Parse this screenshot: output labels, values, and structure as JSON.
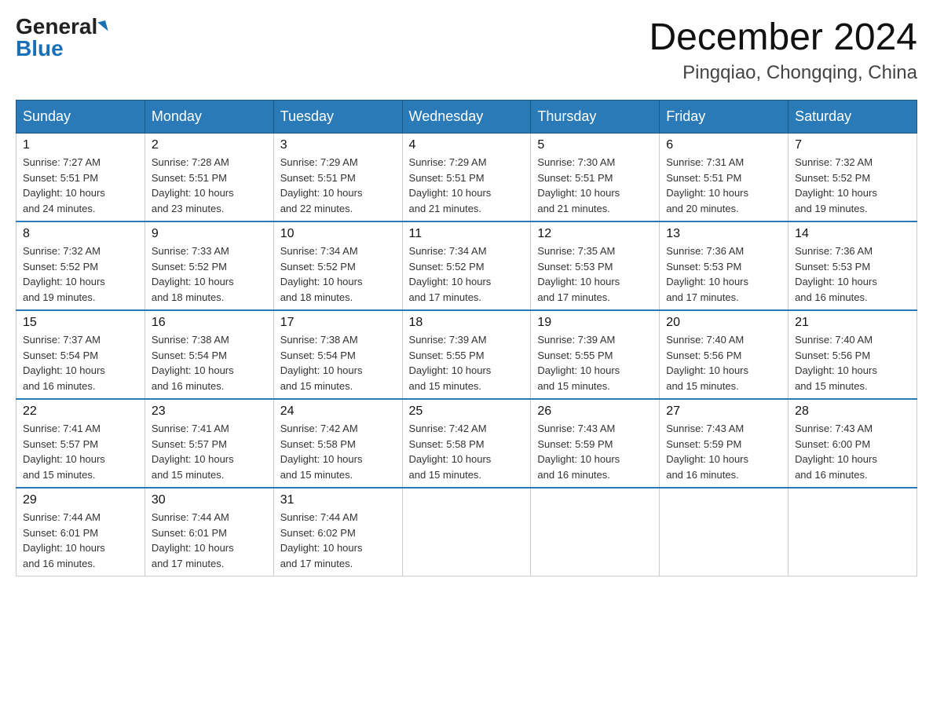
{
  "logo": {
    "line1": "General",
    "line2": "Blue"
  },
  "title": "December 2024",
  "subtitle": "Pingqiao, Chongqing, China",
  "headers": [
    "Sunday",
    "Monday",
    "Tuesday",
    "Wednesday",
    "Thursday",
    "Friday",
    "Saturday"
  ],
  "weeks": [
    [
      {
        "day": "1",
        "info": "Sunrise: 7:27 AM\nSunset: 5:51 PM\nDaylight: 10 hours\nand 24 minutes."
      },
      {
        "day": "2",
        "info": "Sunrise: 7:28 AM\nSunset: 5:51 PM\nDaylight: 10 hours\nand 23 minutes."
      },
      {
        "day": "3",
        "info": "Sunrise: 7:29 AM\nSunset: 5:51 PM\nDaylight: 10 hours\nand 22 minutes."
      },
      {
        "day": "4",
        "info": "Sunrise: 7:29 AM\nSunset: 5:51 PM\nDaylight: 10 hours\nand 21 minutes."
      },
      {
        "day": "5",
        "info": "Sunrise: 7:30 AM\nSunset: 5:51 PM\nDaylight: 10 hours\nand 21 minutes."
      },
      {
        "day": "6",
        "info": "Sunrise: 7:31 AM\nSunset: 5:51 PM\nDaylight: 10 hours\nand 20 minutes."
      },
      {
        "day": "7",
        "info": "Sunrise: 7:32 AM\nSunset: 5:52 PM\nDaylight: 10 hours\nand 19 minutes."
      }
    ],
    [
      {
        "day": "8",
        "info": "Sunrise: 7:32 AM\nSunset: 5:52 PM\nDaylight: 10 hours\nand 19 minutes."
      },
      {
        "day": "9",
        "info": "Sunrise: 7:33 AM\nSunset: 5:52 PM\nDaylight: 10 hours\nand 18 minutes."
      },
      {
        "day": "10",
        "info": "Sunrise: 7:34 AM\nSunset: 5:52 PM\nDaylight: 10 hours\nand 18 minutes."
      },
      {
        "day": "11",
        "info": "Sunrise: 7:34 AM\nSunset: 5:52 PM\nDaylight: 10 hours\nand 17 minutes."
      },
      {
        "day": "12",
        "info": "Sunrise: 7:35 AM\nSunset: 5:53 PM\nDaylight: 10 hours\nand 17 minutes."
      },
      {
        "day": "13",
        "info": "Sunrise: 7:36 AM\nSunset: 5:53 PM\nDaylight: 10 hours\nand 17 minutes."
      },
      {
        "day": "14",
        "info": "Sunrise: 7:36 AM\nSunset: 5:53 PM\nDaylight: 10 hours\nand 16 minutes."
      }
    ],
    [
      {
        "day": "15",
        "info": "Sunrise: 7:37 AM\nSunset: 5:54 PM\nDaylight: 10 hours\nand 16 minutes."
      },
      {
        "day": "16",
        "info": "Sunrise: 7:38 AM\nSunset: 5:54 PM\nDaylight: 10 hours\nand 16 minutes."
      },
      {
        "day": "17",
        "info": "Sunrise: 7:38 AM\nSunset: 5:54 PM\nDaylight: 10 hours\nand 15 minutes."
      },
      {
        "day": "18",
        "info": "Sunrise: 7:39 AM\nSunset: 5:55 PM\nDaylight: 10 hours\nand 15 minutes."
      },
      {
        "day": "19",
        "info": "Sunrise: 7:39 AM\nSunset: 5:55 PM\nDaylight: 10 hours\nand 15 minutes."
      },
      {
        "day": "20",
        "info": "Sunrise: 7:40 AM\nSunset: 5:56 PM\nDaylight: 10 hours\nand 15 minutes."
      },
      {
        "day": "21",
        "info": "Sunrise: 7:40 AM\nSunset: 5:56 PM\nDaylight: 10 hours\nand 15 minutes."
      }
    ],
    [
      {
        "day": "22",
        "info": "Sunrise: 7:41 AM\nSunset: 5:57 PM\nDaylight: 10 hours\nand 15 minutes."
      },
      {
        "day": "23",
        "info": "Sunrise: 7:41 AM\nSunset: 5:57 PM\nDaylight: 10 hours\nand 15 minutes."
      },
      {
        "day": "24",
        "info": "Sunrise: 7:42 AM\nSunset: 5:58 PM\nDaylight: 10 hours\nand 15 minutes."
      },
      {
        "day": "25",
        "info": "Sunrise: 7:42 AM\nSunset: 5:58 PM\nDaylight: 10 hours\nand 15 minutes."
      },
      {
        "day": "26",
        "info": "Sunrise: 7:43 AM\nSunset: 5:59 PM\nDaylight: 10 hours\nand 16 minutes."
      },
      {
        "day": "27",
        "info": "Sunrise: 7:43 AM\nSunset: 5:59 PM\nDaylight: 10 hours\nand 16 minutes."
      },
      {
        "day": "28",
        "info": "Sunrise: 7:43 AM\nSunset: 6:00 PM\nDaylight: 10 hours\nand 16 minutes."
      }
    ],
    [
      {
        "day": "29",
        "info": "Sunrise: 7:44 AM\nSunset: 6:01 PM\nDaylight: 10 hours\nand 16 minutes."
      },
      {
        "day": "30",
        "info": "Sunrise: 7:44 AM\nSunset: 6:01 PM\nDaylight: 10 hours\nand 17 minutes."
      },
      {
        "day": "31",
        "info": "Sunrise: 7:44 AM\nSunset: 6:02 PM\nDaylight: 10 hours\nand 17 minutes."
      },
      null,
      null,
      null,
      null
    ]
  ]
}
